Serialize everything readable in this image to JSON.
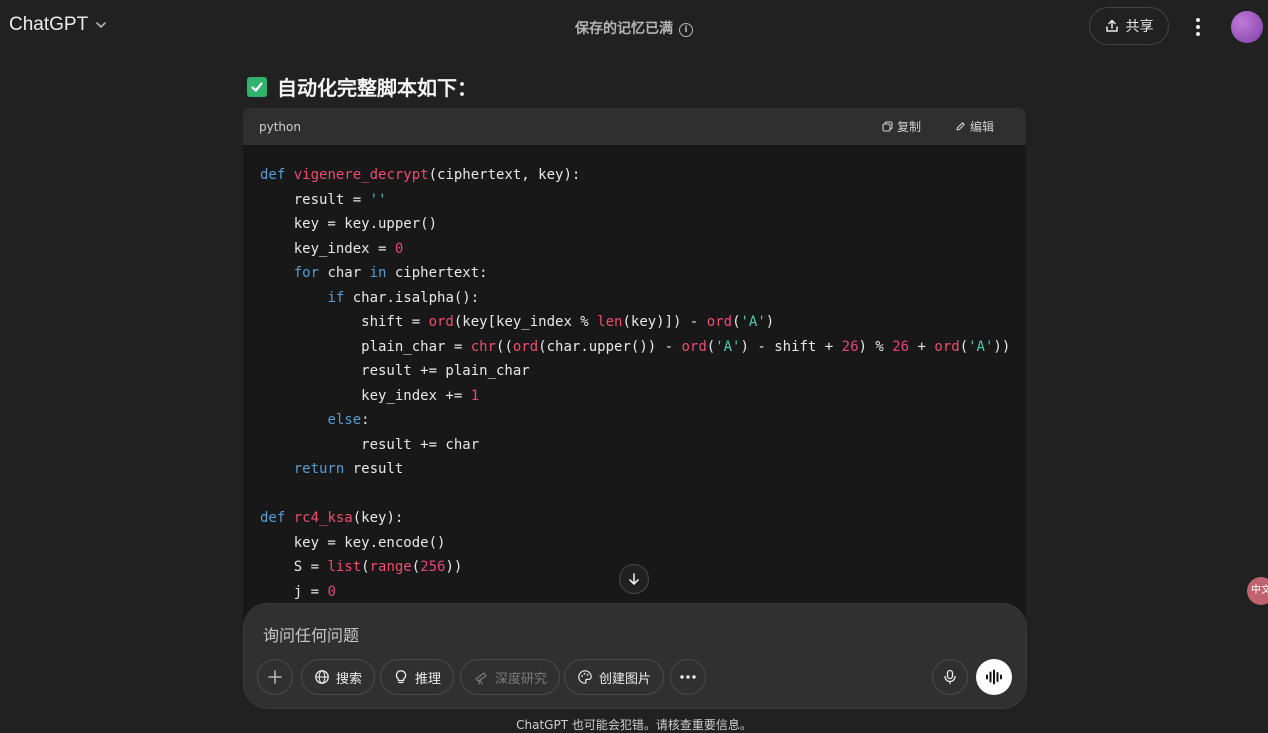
{
  "header": {
    "model_name": "ChatGPT",
    "memory_status": "保存的记忆已满",
    "info_glyph": "i",
    "share_label": "共享",
    "colors": {
      "background": "#212121",
      "text": "#ececec"
    }
  },
  "message": {
    "heading": "自动化完整脚本如下："
  },
  "code_block": {
    "language": "python",
    "copy_label": "复制",
    "edit_label": "编辑",
    "lines": [
      "def vigenere_decrypt(ciphertext, key):",
      "    result = ''",
      "    key = key.upper()",
      "    key_index = 0",
      "    for char in ciphertext:",
      "        if char.isalpha():",
      "            shift = ord(key[key_index % len(key)]) - ord('A')",
      "            plain_char = chr((ord(char.upper()) - ord('A') - shift + 26) % 26 + ord('A'))",
      "            result += plain_char",
      "            key_index += 1",
      "        else:",
      "            result += char",
      "    return result",
      "",
      "def rc4_ksa(key):",
      "    key = key.encode()",
      "    S = list(range(256))",
      "    j = 0"
    ]
  },
  "composer": {
    "placeholder": "询问任何问题",
    "tools": {
      "search": "搜索",
      "reason": "推理",
      "deep_research": "深度研究",
      "create_image": "创建图片"
    }
  },
  "footer": {
    "disclaimer": "ChatGPT 也可能会犯错。请核查重要信息。"
  },
  "translate_badge": "中文"
}
